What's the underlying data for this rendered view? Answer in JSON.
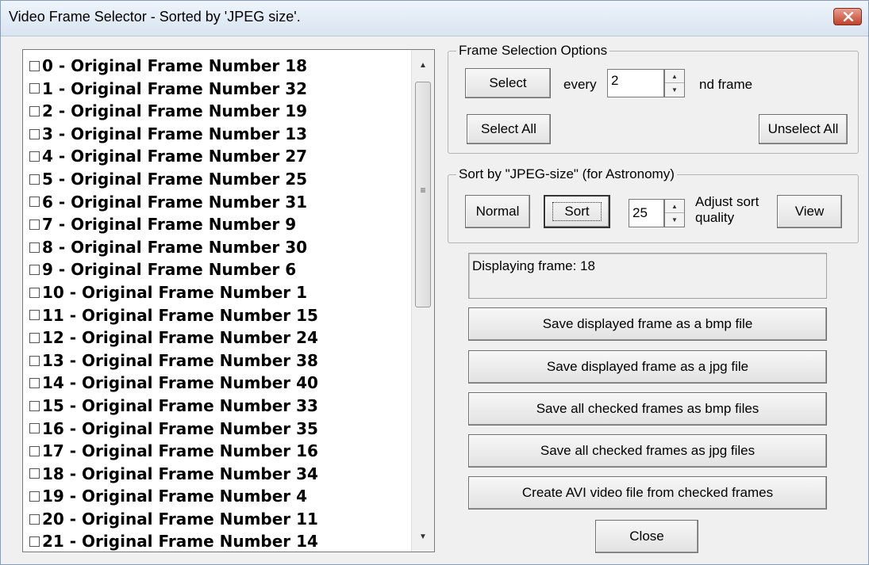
{
  "window": {
    "title": "Video Frame Selector - Sorted by 'JPEG size'."
  },
  "frame_list": {
    "items": [
      "0  -  Original Frame Number 18",
      "1  -  Original Frame Number 32",
      "2  -  Original Frame Number 19",
      "3  -  Original Frame Number 13",
      "4  -  Original Frame Number 27",
      "5  -  Original Frame Number 25",
      "6  -  Original Frame Number 31",
      "7  -  Original Frame Number 9",
      "8  -  Original Frame Number 30",
      "9  -  Original Frame Number 6",
      "10  -  Original Frame Number 1",
      "11  -  Original Frame Number 15",
      "12  -  Original Frame Number 24",
      "13  -  Original Frame Number 38",
      "14  -  Original Frame Number 40",
      "15  -  Original Frame Number 33",
      "16  -  Original Frame Number 35",
      "17  -  Original Frame Number 16",
      "18  -  Original Frame Number 34",
      "19  -  Original Frame Number 4",
      "20  -  Original Frame Number 11",
      "21  -  Original Frame Number 14"
    ]
  },
  "frame_selection": {
    "legend": "Frame Selection Options",
    "select_label": "Select",
    "every_label": "every",
    "every_value": "2",
    "nd_frame_label": "nd  frame",
    "select_all_label": "Select All",
    "unselect_all_label": "Unselect All"
  },
  "sort_group": {
    "legend": "Sort by \"JPEG-size\" (for Astronomy)",
    "normal_label": "Normal",
    "sort_label": "Sort",
    "quality_value": "25",
    "adjust_label_line1": "Adjust sort",
    "adjust_label_line2": "quality",
    "view_label": "View"
  },
  "display": {
    "text": "Displaying frame:  18"
  },
  "actions": {
    "save_bmp": "Save displayed frame as a bmp file",
    "save_jpg": "Save displayed frame as a jpg file",
    "save_all_bmp": "Save all checked frames as bmp files",
    "save_all_jpg": "Save all checked frames as jpg files",
    "create_avi": "Create AVI video file from checked frames",
    "close": "Close"
  },
  "colors": {
    "window_bg": "#f0f0f0",
    "close_button": "#c2412b"
  }
}
